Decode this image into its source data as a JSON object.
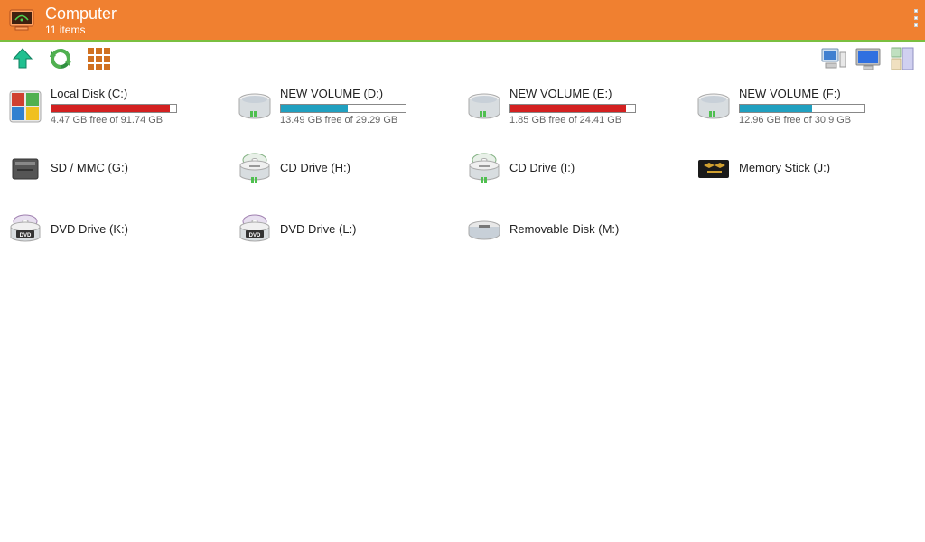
{
  "header": {
    "title": "Computer",
    "subtitle": "11 items"
  },
  "colors": {
    "accent": "#f08030",
    "bar_red": "#d32020",
    "bar_cyan": "#20a0c0",
    "bar_border": "#888"
  },
  "drives": [
    {
      "name": "Local Disk (C:)",
      "icon": "hdd-windows",
      "free_text": "4.47 GB free of 91.74 GB",
      "used_gb": 87.27,
      "total_gb": 91.74,
      "bar_color": "#d32020",
      "has_bar": true
    },
    {
      "name": "NEW VOLUME (D:)",
      "icon": "hdd",
      "free_text": "13.49 GB free of 29.29 GB",
      "used_gb": 15.8,
      "total_gb": 29.29,
      "bar_color": "#20a0c0",
      "has_bar": true
    },
    {
      "name": "NEW VOLUME (E:)",
      "icon": "hdd",
      "free_text": "1.85 GB free of 24.41 GB",
      "used_gb": 22.56,
      "total_gb": 24.41,
      "bar_color": "#d32020",
      "has_bar": true
    },
    {
      "name": "NEW VOLUME (F:)",
      "icon": "hdd",
      "free_text": "12.96 GB free of 30.9 GB",
      "used_gb": 17.94,
      "total_gb": 30.9,
      "bar_color": "#20a0c0",
      "has_bar": true
    },
    {
      "name": "SD / MMC (G:)",
      "icon": "sd",
      "has_bar": false
    },
    {
      "name": "CD Drive (H:)",
      "icon": "cd",
      "has_bar": false
    },
    {
      "name": "CD Drive (I:)",
      "icon": "cd",
      "has_bar": false
    },
    {
      "name": "Memory Stick (J:)",
      "icon": "memstick",
      "has_bar": false
    },
    {
      "name": "DVD Drive (K:)",
      "icon": "dvd",
      "has_bar": false
    },
    {
      "name": "DVD Drive (L:)",
      "icon": "dvd",
      "has_bar": false
    },
    {
      "name": "Removable Disk (M:)",
      "icon": "removable",
      "has_bar": false
    }
  ]
}
